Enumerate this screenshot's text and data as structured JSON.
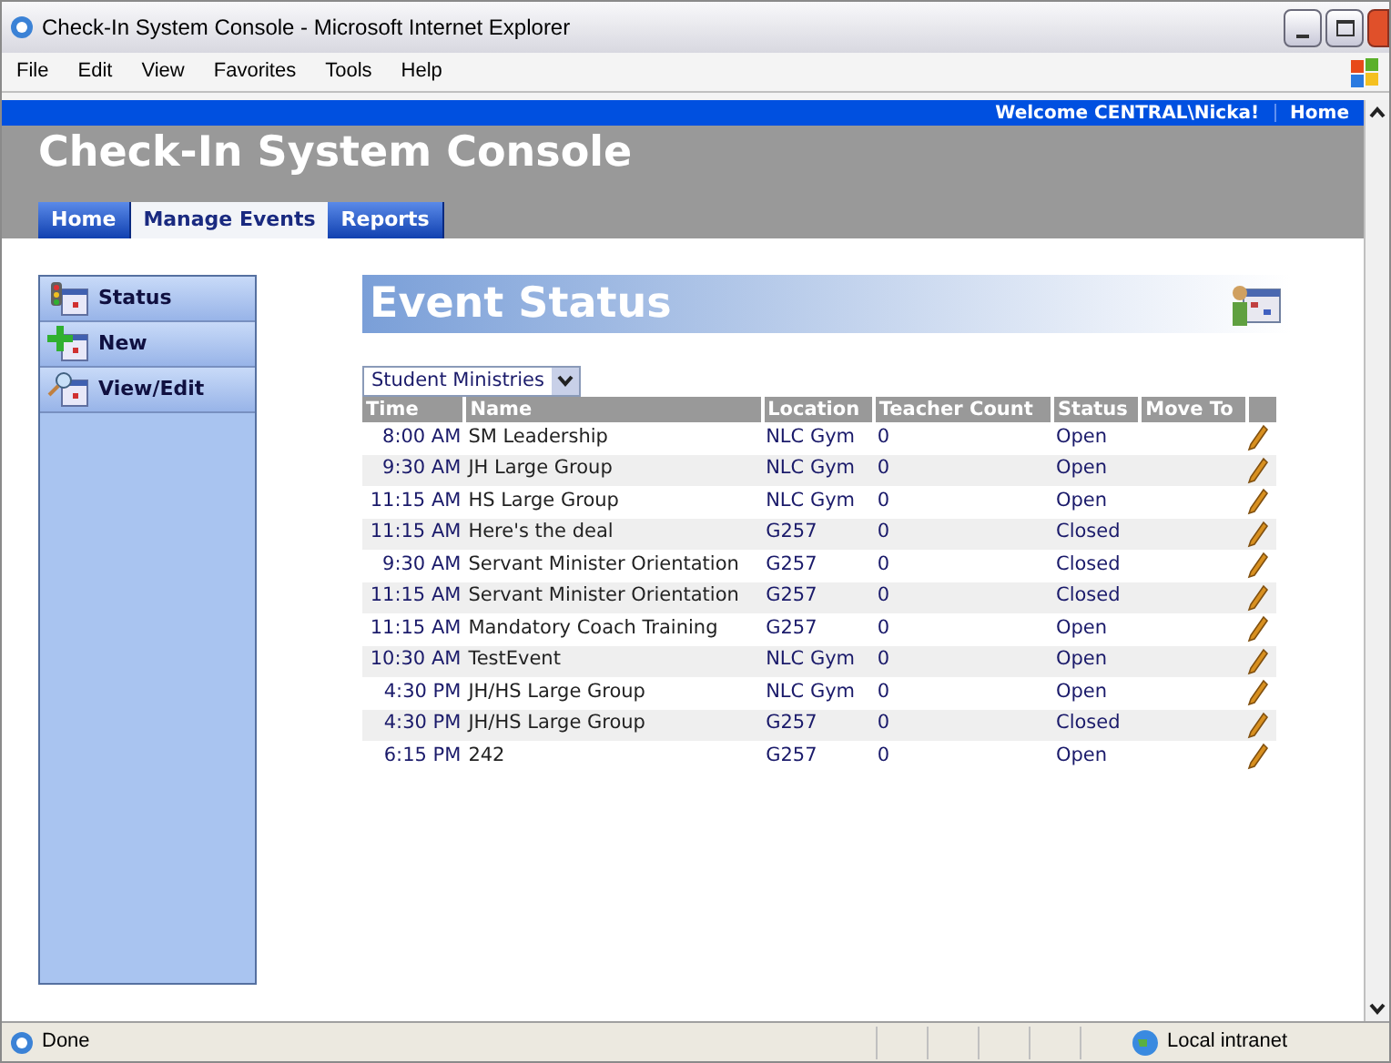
{
  "window": {
    "title": "Check-In System Console - Microsoft Internet Explorer"
  },
  "menu": [
    "File",
    "Edit",
    "View",
    "Favorites",
    "Tools",
    "Help"
  ],
  "topbar": {
    "welcome": "Welcome CENTRAL\\Nicka!",
    "home_link": "Home"
  },
  "site_title": "Check-In System Console",
  "tabs": [
    {
      "label": "Home",
      "selected": false
    },
    {
      "label": "Manage Events",
      "selected": true
    },
    {
      "label": "Reports",
      "selected": false
    }
  ],
  "sidebar": {
    "items": [
      {
        "label": "Status",
        "kind": "status"
      },
      {
        "label": "New",
        "kind": "new"
      },
      {
        "label": "View/Edit",
        "kind": "view"
      }
    ]
  },
  "heading": "Event Status",
  "filter": {
    "value": "Student Ministries"
  },
  "table": {
    "columns": [
      "Time",
      "Name",
      "Location",
      "Teacher Count",
      "Status",
      "Move To"
    ],
    "rows": [
      {
        "time": "8:00 AM",
        "name": "SM Leadership",
        "location": "NLC Gym",
        "teacher_count": "0",
        "status": "Open"
      },
      {
        "time": "9:30 AM",
        "name": "JH Large Group",
        "location": "NLC Gym",
        "teacher_count": "0",
        "status": "Open"
      },
      {
        "time": "11:15 AM",
        "name": "HS Large Group",
        "location": "NLC Gym",
        "teacher_count": "0",
        "status": "Open"
      },
      {
        "time": "11:15 AM",
        "name": "Here's the deal",
        "location": "G257",
        "teacher_count": "0",
        "status": "Closed"
      },
      {
        "time": "9:30 AM",
        "name": "Servant Minister Orientation",
        "location": "G257",
        "teacher_count": "0",
        "status": "Closed"
      },
      {
        "time": "11:15 AM",
        "name": "Servant Minister Orientation",
        "location": "G257",
        "teacher_count": "0",
        "status": "Closed"
      },
      {
        "time": "11:15 AM",
        "name": "Mandatory Coach Training",
        "location": "G257",
        "teacher_count": "0",
        "status": "Open"
      },
      {
        "time": "10:30 AM",
        "name": "TestEvent",
        "location": "NLC Gym",
        "teacher_count": "0",
        "status": "Open"
      },
      {
        "time": "4:30 PM",
        "name": "JH/HS Large Group",
        "location": "NLC Gym",
        "teacher_count": "0",
        "status": "Open"
      },
      {
        "time": "4:30 PM",
        "name": "JH/HS Large Group",
        "location": "G257",
        "teacher_count": "0",
        "status": "Closed"
      },
      {
        "time": "6:15 PM",
        "name": "242",
        "location": "G257",
        "teacher_count": "0",
        "status": "Open"
      }
    ]
  },
  "status_bar": {
    "text": "Done",
    "zone": "Local intranet"
  }
}
